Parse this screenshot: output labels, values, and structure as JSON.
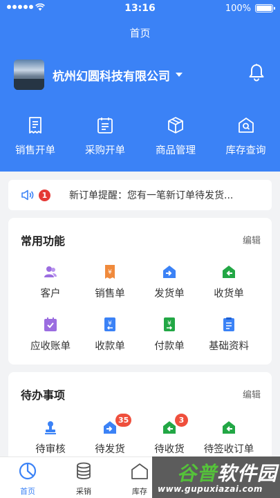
{
  "status_bar": {
    "time": "13:16",
    "battery": "100%"
  },
  "nav": {
    "title": "首页"
  },
  "company": {
    "name": "杭州幻圆科技有限公司"
  },
  "quick_actions": [
    {
      "label": "销售开单",
      "icon": "receipt-icon"
    },
    {
      "label": "采购开单",
      "icon": "purchase-form-icon"
    },
    {
      "label": "商品管理",
      "icon": "box-icon"
    },
    {
      "label": "库存查询",
      "icon": "warehouse-search-icon"
    }
  ],
  "notice": {
    "count": "1",
    "text": "新订单提醒：您有一笔新订单待发货..."
  },
  "common": {
    "title": "常用功能",
    "edit": "编辑",
    "items": [
      {
        "label": "客户",
        "icon": "customers-icon",
        "color": "#9b6de0"
      },
      {
        "label": "销售单",
        "icon": "sales-order-icon",
        "color": "#f08a3c"
      },
      {
        "label": "发货单",
        "icon": "shipping-icon",
        "color": "#3b82f6"
      },
      {
        "label": "收货单",
        "icon": "receiving-icon",
        "color": "#22a745"
      },
      {
        "label": "应收账单",
        "icon": "receivable-icon",
        "color": "#9b6de0"
      },
      {
        "label": "收款单",
        "icon": "collection-icon",
        "color": "#3b82f6"
      },
      {
        "label": "付款单",
        "icon": "payment-icon",
        "color": "#22a745"
      },
      {
        "label": "基础资料",
        "icon": "basic-data-icon",
        "color": "#3b82f6"
      }
    ]
  },
  "todo": {
    "title": "待办事项",
    "edit": "编辑",
    "items": [
      {
        "label": "待审核",
        "icon": "review-stamp-icon",
        "color": "#3b82f6",
        "badge": ""
      },
      {
        "label": "待发货",
        "icon": "shipping-icon",
        "color": "#3b82f6",
        "badge": "35"
      },
      {
        "label": "待收货",
        "icon": "receiving-icon",
        "color": "#22a745",
        "badge": "3"
      },
      {
        "label": "待签收订单",
        "icon": "receiving-icon",
        "color": "#22a745",
        "badge": ""
      }
    ]
  },
  "tabs": [
    {
      "label": "首页",
      "icon": "home-pie-icon"
    },
    {
      "label": "采销",
      "icon": "database-icon"
    },
    {
      "label": "库存",
      "icon": "inventory-icon"
    }
  ],
  "watermark": {
    "main_a": "谷普",
    "main_b": "软件园",
    "url": "www.gupuxiazai.com"
  }
}
